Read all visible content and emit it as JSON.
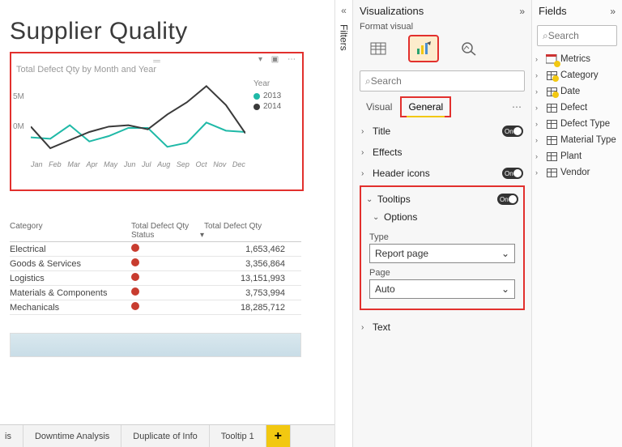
{
  "page": {
    "title": "Supplier Quality"
  },
  "chart": {
    "title": "Total Defect Qty by Month and Year",
    "legend_header": "Year",
    "series": [
      {
        "name": "2013",
        "color": "#1fb9a7"
      },
      {
        "name": "2014",
        "color": "#3a3a3a"
      }
    ],
    "yticks": [
      "5M",
      "0M"
    ],
    "xticks": [
      "Jan",
      "Feb",
      "Mar",
      "Apr",
      "May",
      "Jun",
      "Jul",
      "Aug",
      "Sep",
      "Oct",
      "Nov",
      "Dec"
    ]
  },
  "chart_data": {
    "type": "line",
    "title": "Total Defect Qty by Month and Year",
    "xlabel": "",
    "ylabel": "",
    "ylim": [
      0,
      6000000
    ],
    "categories": [
      "Jan",
      "Feb",
      "Mar",
      "Apr",
      "May",
      "Jun",
      "Jul",
      "Aug",
      "Sep",
      "Oct",
      "Nov",
      "Dec"
    ],
    "series": [
      {
        "name": "2013",
        "color": "#1fb9a7",
        "values": [
          1700000,
          1600000,
          2600000,
          1400000,
          1800000,
          2400000,
          2400000,
          1000000,
          1300000,
          2800000,
          2200000,
          2100000
        ]
      },
      {
        "name": "2014",
        "color": "#3a3a3a",
        "values": [
          2500000,
          900000,
          1500000,
          2100000,
          2500000,
          2600000,
          2300000,
          3400000,
          4300000,
          5500000,
          4100000,
          2000000
        ]
      }
    ]
  },
  "table": {
    "headers": {
      "c1": "Category",
      "c2": "Total Defect Qty Status",
      "c3": "Total Defect Qty"
    },
    "rows": [
      {
        "cat": "Electrical",
        "qty": "1,653,462"
      },
      {
        "cat": "Goods & Services",
        "qty": "3,356,864"
      },
      {
        "cat": "Logistics",
        "qty": "13,151,993"
      },
      {
        "cat": "Materials & Components",
        "qty": "3,753,994"
      },
      {
        "cat": "Mechanicals",
        "qty": "18,285,712"
      }
    ]
  },
  "tabs": [
    "is",
    "Downtime Analysis",
    "Duplicate of Info",
    "Tooltip 1"
  ],
  "filters_label": "Filters",
  "vis": {
    "title": "Visualizations",
    "subtitle": "Format visual",
    "search_placeholder": "Search",
    "tabs": {
      "visual": "Visual",
      "general": "General"
    },
    "sections": {
      "title": "Title",
      "effects": "Effects",
      "header_icons": "Header icons",
      "tooltips": "Tooltips",
      "options": "Options",
      "type_label": "Type",
      "type_value": "Report page",
      "page_label": "Page",
      "page_value": "Auto",
      "text": "Text",
      "on": "On"
    }
  },
  "fields": {
    "title": "Fields",
    "search_placeholder": "Search",
    "items": [
      {
        "name": "Metrics",
        "checked": true,
        "special": true
      },
      {
        "name": "Category",
        "checked": true
      },
      {
        "name": "Date",
        "checked": true
      },
      {
        "name": "Defect",
        "checked": false
      },
      {
        "name": "Defect Type",
        "checked": false
      },
      {
        "name": "Material Type",
        "checked": false
      },
      {
        "name": "Plant",
        "checked": false
      },
      {
        "name": "Vendor",
        "checked": false
      }
    ]
  }
}
